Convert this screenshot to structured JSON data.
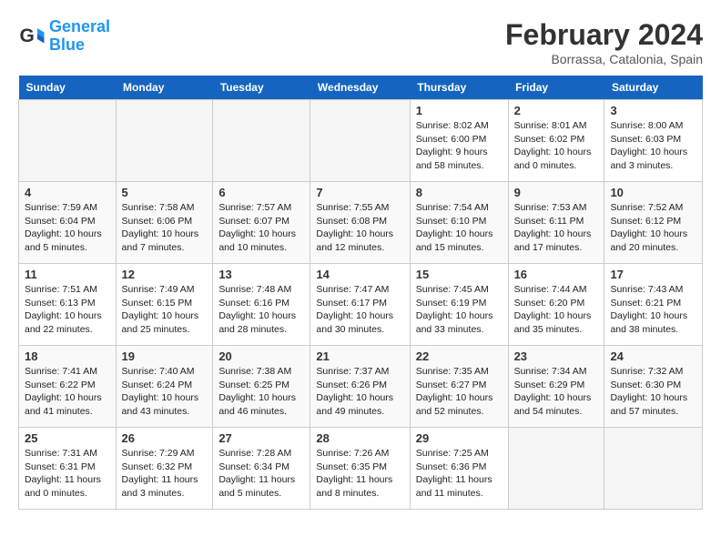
{
  "header": {
    "logo_general": "General",
    "logo_blue": "Blue",
    "month": "February 2024",
    "location": "Borrassa, Catalonia, Spain"
  },
  "weekdays": [
    "Sunday",
    "Monday",
    "Tuesday",
    "Wednesday",
    "Thursday",
    "Friday",
    "Saturday"
  ],
  "weeks": [
    [
      {
        "day": "",
        "info": ""
      },
      {
        "day": "",
        "info": ""
      },
      {
        "day": "",
        "info": ""
      },
      {
        "day": "",
        "info": ""
      },
      {
        "day": "1",
        "info": "Sunrise: 8:02 AM\nSunset: 6:00 PM\nDaylight: 9 hours\nand 58 minutes."
      },
      {
        "day": "2",
        "info": "Sunrise: 8:01 AM\nSunset: 6:02 PM\nDaylight: 10 hours\nand 0 minutes."
      },
      {
        "day": "3",
        "info": "Sunrise: 8:00 AM\nSunset: 6:03 PM\nDaylight: 10 hours\nand 3 minutes."
      }
    ],
    [
      {
        "day": "4",
        "info": "Sunrise: 7:59 AM\nSunset: 6:04 PM\nDaylight: 10 hours\nand 5 minutes."
      },
      {
        "day": "5",
        "info": "Sunrise: 7:58 AM\nSunset: 6:06 PM\nDaylight: 10 hours\nand 7 minutes."
      },
      {
        "day": "6",
        "info": "Sunrise: 7:57 AM\nSunset: 6:07 PM\nDaylight: 10 hours\nand 10 minutes."
      },
      {
        "day": "7",
        "info": "Sunrise: 7:55 AM\nSunset: 6:08 PM\nDaylight: 10 hours\nand 12 minutes."
      },
      {
        "day": "8",
        "info": "Sunrise: 7:54 AM\nSunset: 6:10 PM\nDaylight: 10 hours\nand 15 minutes."
      },
      {
        "day": "9",
        "info": "Sunrise: 7:53 AM\nSunset: 6:11 PM\nDaylight: 10 hours\nand 17 minutes."
      },
      {
        "day": "10",
        "info": "Sunrise: 7:52 AM\nSunset: 6:12 PM\nDaylight: 10 hours\nand 20 minutes."
      }
    ],
    [
      {
        "day": "11",
        "info": "Sunrise: 7:51 AM\nSunset: 6:13 PM\nDaylight: 10 hours\nand 22 minutes."
      },
      {
        "day": "12",
        "info": "Sunrise: 7:49 AM\nSunset: 6:15 PM\nDaylight: 10 hours\nand 25 minutes."
      },
      {
        "day": "13",
        "info": "Sunrise: 7:48 AM\nSunset: 6:16 PM\nDaylight: 10 hours\nand 28 minutes."
      },
      {
        "day": "14",
        "info": "Sunrise: 7:47 AM\nSunset: 6:17 PM\nDaylight: 10 hours\nand 30 minutes."
      },
      {
        "day": "15",
        "info": "Sunrise: 7:45 AM\nSunset: 6:19 PM\nDaylight: 10 hours\nand 33 minutes."
      },
      {
        "day": "16",
        "info": "Sunrise: 7:44 AM\nSunset: 6:20 PM\nDaylight: 10 hours\nand 35 minutes."
      },
      {
        "day": "17",
        "info": "Sunrise: 7:43 AM\nSunset: 6:21 PM\nDaylight: 10 hours\nand 38 minutes."
      }
    ],
    [
      {
        "day": "18",
        "info": "Sunrise: 7:41 AM\nSunset: 6:22 PM\nDaylight: 10 hours\nand 41 minutes."
      },
      {
        "day": "19",
        "info": "Sunrise: 7:40 AM\nSunset: 6:24 PM\nDaylight: 10 hours\nand 43 minutes."
      },
      {
        "day": "20",
        "info": "Sunrise: 7:38 AM\nSunset: 6:25 PM\nDaylight: 10 hours\nand 46 minutes."
      },
      {
        "day": "21",
        "info": "Sunrise: 7:37 AM\nSunset: 6:26 PM\nDaylight: 10 hours\nand 49 minutes."
      },
      {
        "day": "22",
        "info": "Sunrise: 7:35 AM\nSunset: 6:27 PM\nDaylight: 10 hours\nand 52 minutes."
      },
      {
        "day": "23",
        "info": "Sunrise: 7:34 AM\nSunset: 6:29 PM\nDaylight: 10 hours\nand 54 minutes."
      },
      {
        "day": "24",
        "info": "Sunrise: 7:32 AM\nSunset: 6:30 PM\nDaylight: 10 hours\nand 57 minutes."
      }
    ],
    [
      {
        "day": "25",
        "info": "Sunrise: 7:31 AM\nSunset: 6:31 PM\nDaylight: 11 hours\nand 0 minutes."
      },
      {
        "day": "26",
        "info": "Sunrise: 7:29 AM\nSunset: 6:32 PM\nDaylight: 11 hours\nand 3 minutes."
      },
      {
        "day": "27",
        "info": "Sunrise: 7:28 AM\nSunset: 6:34 PM\nDaylight: 11 hours\nand 5 minutes."
      },
      {
        "day": "28",
        "info": "Sunrise: 7:26 AM\nSunset: 6:35 PM\nDaylight: 11 hours\nand 8 minutes."
      },
      {
        "day": "29",
        "info": "Sunrise: 7:25 AM\nSunset: 6:36 PM\nDaylight: 11 hours\nand 11 minutes."
      },
      {
        "day": "",
        "info": ""
      },
      {
        "day": "",
        "info": ""
      }
    ]
  ]
}
